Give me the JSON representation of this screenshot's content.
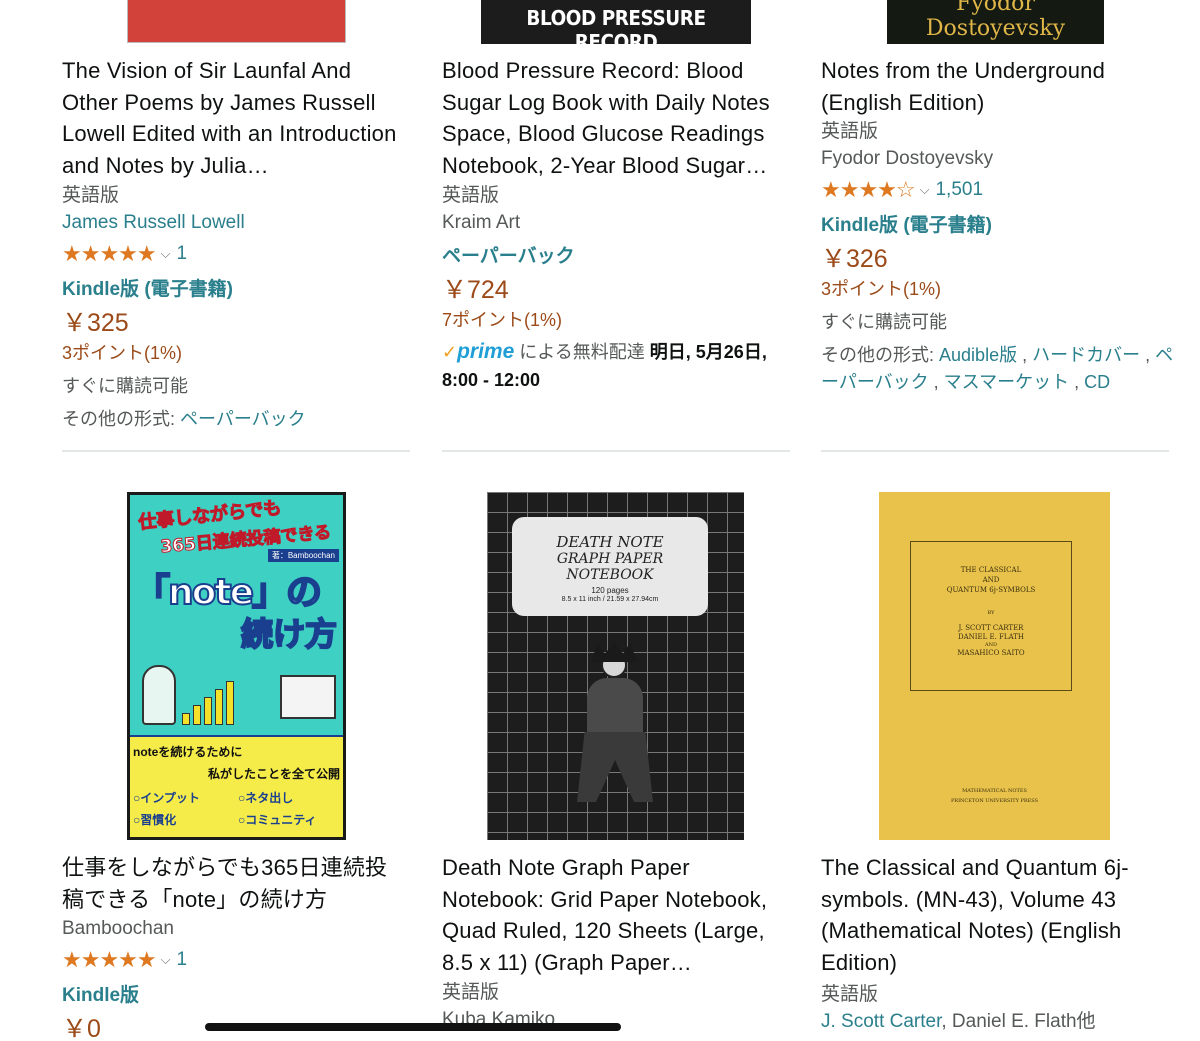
{
  "row1": [
    {
      "title": "The Vision of Sir Launfal And Other Poems by James Russell Lowell Edited with an Introduction and Notes by Julia…",
      "edition": "英語版",
      "author": "James Russell Lowell",
      "rating_stars": "★★★★★",
      "rating_count": "1",
      "format": "Kindle版 (電子書籍)",
      "price": "￥325",
      "points": "3ポイント(1%)",
      "availability": "すぐに購読可能",
      "other_formats_label": "その他の形式:",
      "other_formats": "ペーパーバック"
    },
    {
      "cover_text": "BLOOD PRESSURE RECORD",
      "title": "Blood Pressure Record: Blood Sugar Log Book with Daily Notes Space, Blood Glucose Readings Notebook, 2-Year Blood Sugar…",
      "edition": "英語版",
      "author": "Kraim Art",
      "format": "ペーパーバック",
      "price": "￥724",
      "points": "7ポイント(1%)",
      "check": "✓",
      "prime": "prime",
      "delivery_text": "による無料配達",
      "delivery_date": "明日, 5月26日,",
      "delivery_time": "8:00 - 12:00"
    },
    {
      "cover_text": "Fyodor Dostoyevsky",
      "title": "Notes from the Underground (English Edition)",
      "edition": "英語版",
      "author": "Fyodor Dostoyevsky",
      "rating_stars": "★★★★☆",
      "rating_count": "1,501",
      "format": "Kindle版 (電子書籍)",
      "price": "￥326",
      "points": "3ポイント(1%)",
      "availability": "すぐに購読可能",
      "other_formats_label": "その他の形式:",
      "other_formats_1": "Audible版",
      "other_formats_2": "ハードカバー",
      "other_formats_3": "ペーパーバック",
      "other_formats_4": "マスマーケット",
      "other_formats_5": "CD"
    }
  ],
  "row2": [
    {
      "cover": {
        "line1": "仕事しながらでも",
        "line2": "365日連続投稿できる",
        "byline": "著：Bamboochan",
        "big1": "「note」の",
        "big2": "続け方",
        "box1": "noteを続けるために",
        "box2": "私がしたことを全て公開",
        "item1": "○インプット",
        "item2": "○ネタ出し",
        "item3": "○習慣化",
        "item4": "○コミュニティ"
      },
      "title": "仕事をしながらでも365日連続投稿できる「note」の続け方",
      "author": "Bamboochan",
      "rating_stars": "★★★★★",
      "rating_count": "1",
      "format": "Kindle版",
      "price": "￥0"
    },
    {
      "cover": {
        "line1": "DEATH NOTE",
        "line2": "GRAPH PAPER NOTEBOOK",
        "pages": "120 pages",
        "size": "8.5 x 11 inch / 21.59 x 27.94cm"
      },
      "title": "Death Note Graph Paper Notebook: Grid Paper Notebook, Quad Ruled, 120 Sheets (Large, 8.5 x 11) (Graph Paper…",
      "edition": "英語版",
      "author": "Kuba Kamiko"
    },
    {
      "cover": {
        "t1": "THE CLASSICAL",
        "t2": "AND",
        "t3": "QUANTUM 6j-SYMBOLS",
        "by": "BY",
        "a1": "J. SCOTT CARTER",
        "a2": "DANIEL E. FLATH",
        "and": "AND",
        "a3": "MASAHICO SAITO",
        "series": "MATHEMATICAL NOTES",
        "press": "PRINCETON UNIVERSITY PRESS"
      },
      "title": "The Classical and Quantum 6j-symbols. (MN-43), Volume 43 (Mathematical Notes) (English Edition)",
      "edition": "英語版",
      "author_link": "J. Scott Carter",
      "author_rest": ", Daniel E. Flath他"
    }
  ],
  "colors": {
    "link": "#2a7f8c",
    "price": "#9b4a18",
    "star": "#de7921",
    "prime": "#1f9fd6"
  }
}
